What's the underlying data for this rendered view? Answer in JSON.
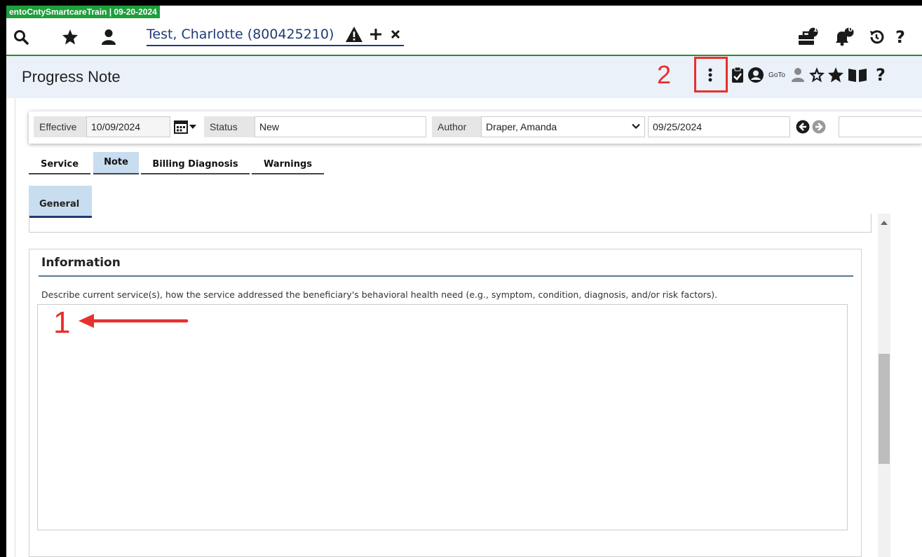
{
  "env_badge": "entoCntySmartcareTrain | 09-20-2024",
  "client": {
    "name": "Test, Charlotte (800425210)"
  },
  "top_icons": {
    "briefcase_count": "1",
    "bell_count": "0"
  },
  "title": "Progress Note",
  "annotations": {
    "one": "1",
    "two": "2"
  },
  "toolbar": {
    "goto_label": "GoTo"
  },
  "filters": {
    "effective_label": "Effective",
    "effective_value": "10/09/2024",
    "status_label": "Status",
    "status_value": "New",
    "author_label": "Author",
    "author_value": "Draper, Amanda",
    "date_value": "09/25/2024"
  },
  "tabs": [
    {
      "label": "Service"
    },
    {
      "label": "Note"
    },
    {
      "label": "Billing Diagnosis"
    },
    {
      "label": "Warnings"
    }
  ],
  "subtabs": [
    {
      "label": "General"
    }
  ],
  "section": {
    "title": "Information",
    "description": "Describe current service(s), how the service addressed the beneficiary's behavioral health need (e.g., symptom, condition, diagnosis, and/or risk factors).",
    "textarea_value": ""
  },
  "colors": {
    "accent_navy": "#1f3b73",
    "env_green": "#1f9e3c",
    "annotation_red": "#e8302d",
    "tab_active": "#c8ddef"
  }
}
